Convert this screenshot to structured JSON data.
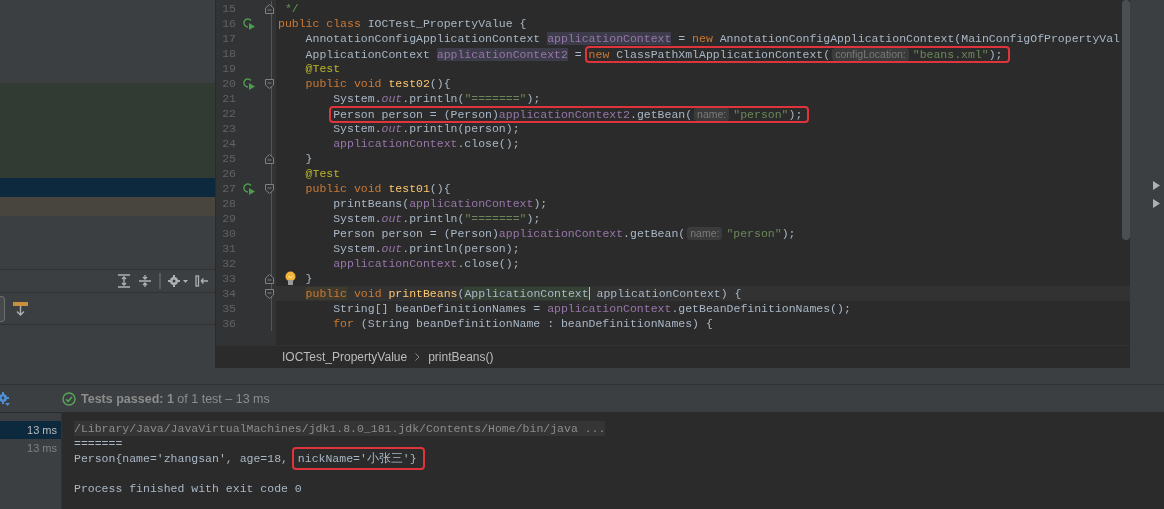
{
  "editor": {
    "lines": [
      {
        "number": "15",
        "fold": {
          "kind": "end"
        },
        "tokens": [
          {
            "kind": "doc",
            "text": " */"
          }
        ]
      },
      {
        "number": "16",
        "gutter": {
          "kind": "run"
        },
        "tokens": [
          {
            "kind": "kw",
            "text": "public class "
          },
          {
            "kind": "plain",
            "text": "IOCTest_PropertyValue {"
          }
        ]
      },
      {
        "number": "17",
        "tokens": [
          {
            "kind": "plain",
            "text": "    AnnotationConfigApplicationContext "
          },
          {
            "kind": "field-mark",
            "text": "applicationContext"
          },
          {
            "kind": "plain",
            "text": " = "
          },
          {
            "kind": "kw",
            "text": "new "
          },
          {
            "kind": "plain",
            "text": "AnnotationConfigApplicationContext(MainConfigOfPropertyVal"
          }
        ]
      },
      {
        "number": "18",
        "tokens": [
          {
            "kind": "plain",
            "text": "    ApplicationContext "
          },
          {
            "kind": "field-mark",
            "text": "applicationContext2"
          },
          {
            "kind": "plain",
            "text": " = "
          },
          {
            "kind": "box",
            "tokens": [
              {
                "kind": "kw",
                "text": "new "
              },
              {
                "kind": "plain",
                "text": "ClassPathXmlApplicationContext("
              },
              {
                "kind": "hint",
                "text": "configLocation:"
              },
              {
                "kind": "str",
                "text": "\"beans.xml\""
              },
              {
                "kind": "plain",
                "text": ");"
              }
            ]
          }
        ]
      },
      {
        "number": "19",
        "tokens": [
          {
            "kind": "ann",
            "text": "    @Test"
          }
        ]
      },
      {
        "number": "20",
        "gutter": {
          "kind": "run"
        },
        "fold": {
          "kind": "start"
        },
        "tokens": [
          {
            "kind": "kw",
            "text": "    public void "
          },
          {
            "kind": "method",
            "text": "test02"
          },
          {
            "kind": "plain",
            "text": "(){"
          }
        ]
      },
      {
        "number": "21",
        "tokens": [
          {
            "kind": "plain",
            "text": "        System."
          },
          {
            "kind": "static",
            "text": "out"
          },
          {
            "kind": "plain",
            "text": ".println("
          },
          {
            "kind": "str",
            "text": "\"=======\""
          },
          {
            "kind": "plain",
            "text": ");"
          }
        ]
      },
      {
        "number": "22",
        "tokens": [
          {
            "kind": "box",
            "tokens": [
              {
                "kind": "plain",
                "text": "        Person person = (Person)"
              },
              {
                "kind": "field",
                "text": "applicationContext2"
              },
              {
                "kind": "plain",
                "text": ".getBean("
              },
              {
                "kind": "hint",
                "text": "name:"
              },
              {
                "kind": "str",
                "text": "\"person\""
              },
              {
                "kind": "plain",
                "text": ");"
              }
            ]
          }
        ]
      },
      {
        "number": "23",
        "tokens": [
          {
            "kind": "plain",
            "text": "        System."
          },
          {
            "kind": "static",
            "text": "out"
          },
          {
            "kind": "plain",
            "text": ".println(person);"
          }
        ]
      },
      {
        "number": "24",
        "tokens": [
          {
            "kind": "field",
            "text": "        applicationContext"
          },
          {
            "kind": "plain",
            "text": ".close();"
          }
        ]
      },
      {
        "number": "25",
        "fold": {
          "kind": "end"
        },
        "tokens": [
          {
            "kind": "plain",
            "text": "    }"
          }
        ]
      },
      {
        "number": "26",
        "tokens": [
          {
            "kind": "ann",
            "text": "    @Test"
          }
        ]
      },
      {
        "number": "27",
        "gutter": {
          "kind": "run"
        },
        "fold": {
          "kind": "start"
        },
        "tokens": [
          {
            "kind": "kw",
            "text": "    public void "
          },
          {
            "kind": "method",
            "text": "test01"
          },
          {
            "kind": "plain",
            "text": "(){"
          }
        ]
      },
      {
        "number": "28",
        "tokens": [
          {
            "kind": "plain",
            "text": "        printBeans("
          },
          {
            "kind": "field",
            "text": "applicationContext"
          },
          {
            "kind": "plain",
            "text": ");"
          }
        ]
      },
      {
        "number": "29",
        "tokens": [
          {
            "kind": "plain",
            "text": "        System."
          },
          {
            "kind": "static",
            "text": "out"
          },
          {
            "kind": "plain",
            "text": ".println("
          },
          {
            "kind": "str",
            "text": "\"=======\""
          },
          {
            "kind": "plain",
            "text": ");"
          }
        ]
      },
      {
        "number": "30",
        "tokens": [
          {
            "kind": "plain",
            "text": "        Person person = (Person)"
          },
          {
            "kind": "field",
            "text": "applicationContext"
          },
          {
            "kind": "plain",
            "text": ".getBean("
          },
          {
            "kind": "hint",
            "text": "name:"
          },
          {
            "kind": "str",
            "text": "\"person\""
          },
          {
            "kind": "plain",
            "text": ");"
          }
        ]
      },
      {
        "number": "31",
        "tokens": [
          {
            "kind": "plain",
            "text": "        System."
          },
          {
            "kind": "static",
            "text": "out"
          },
          {
            "kind": "plain",
            "text": ".println(person);"
          }
        ]
      },
      {
        "number": "32",
        "tokens": [
          {
            "kind": "field",
            "text": "        applicationContext"
          },
          {
            "kind": "plain",
            "text": ".close();"
          }
        ]
      },
      {
        "number": "33",
        "gutter": {
          "kind": "bulb"
        },
        "fold": {
          "kind": "end"
        },
        "tokens": [
          {
            "kind": "plain",
            "text": "    }"
          }
        ]
      },
      {
        "number": "34",
        "current": true,
        "fold": {
          "kind": "start"
        },
        "tokens": [
          {
            "kind": "kw-mark",
            "text": "    public"
          },
          {
            "kind": "kw",
            "text": " void "
          },
          {
            "kind": "method",
            "text": "printBeans"
          },
          {
            "kind": "plain",
            "text": "("
          },
          {
            "kind": "type-mark",
            "text": "ApplicationContext"
          },
          {
            "kind": "caret"
          },
          {
            "kind": "plain",
            "text": " applicationContext) {"
          }
        ]
      },
      {
        "number": "35",
        "tokens": [
          {
            "kind": "plain",
            "text": "        String[] beanDefinitionNames = "
          },
          {
            "kind": "field",
            "text": "applicationContext"
          },
          {
            "kind": "plain",
            "text": ".getBeanDefinitionNames();"
          }
        ]
      },
      {
        "number": "36",
        "tokens": [
          {
            "kind": "kw",
            "text": "        for "
          },
          {
            "kind": "plain",
            "text": "(String beanDefinitionName : beanDefinitionNames) {"
          }
        ]
      }
    ],
    "breadcrumb": [
      "IOCTest_PropertyValue",
      "printBeans()"
    ]
  },
  "test_status": {
    "passed": true,
    "text": "**Tests passed:** **1** of 1 test – 13 ms"
  },
  "durations": [
    {
      "text": "13 ms",
      "selected": true
    },
    {
      "text": "13 ms",
      "selected": false
    }
  ],
  "console": [
    {
      "kind": "command",
      "tokens": [
        {
          "kind": "plain",
          "text": "/Library/Java/JavaVirtualMachines/jdk1.8.0_181.jdk/Contents/Home/bin/java ..."
        }
      ]
    },
    {
      "kind": "output",
      "tokens": [
        {
          "kind": "plain",
          "text": "======="
        }
      ]
    },
    {
      "kind": "output",
      "tokens": [
        {
          "kind": "plain",
          "text": "Person{name='zhangsan', age=18, "
        },
        {
          "kind": "box",
          "tokens": [
            {
              "kind": "plain",
              "text": "nickName='小张三'}"
            }
          ]
        }
      ]
    },
    {
      "kind": "blank"
    },
    {
      "kind": "output",
      "tokens": [
        {
          "kind": "plain",
          "text": "Process finished with exit code 0"
        }
      ]
    }
  ]
}
